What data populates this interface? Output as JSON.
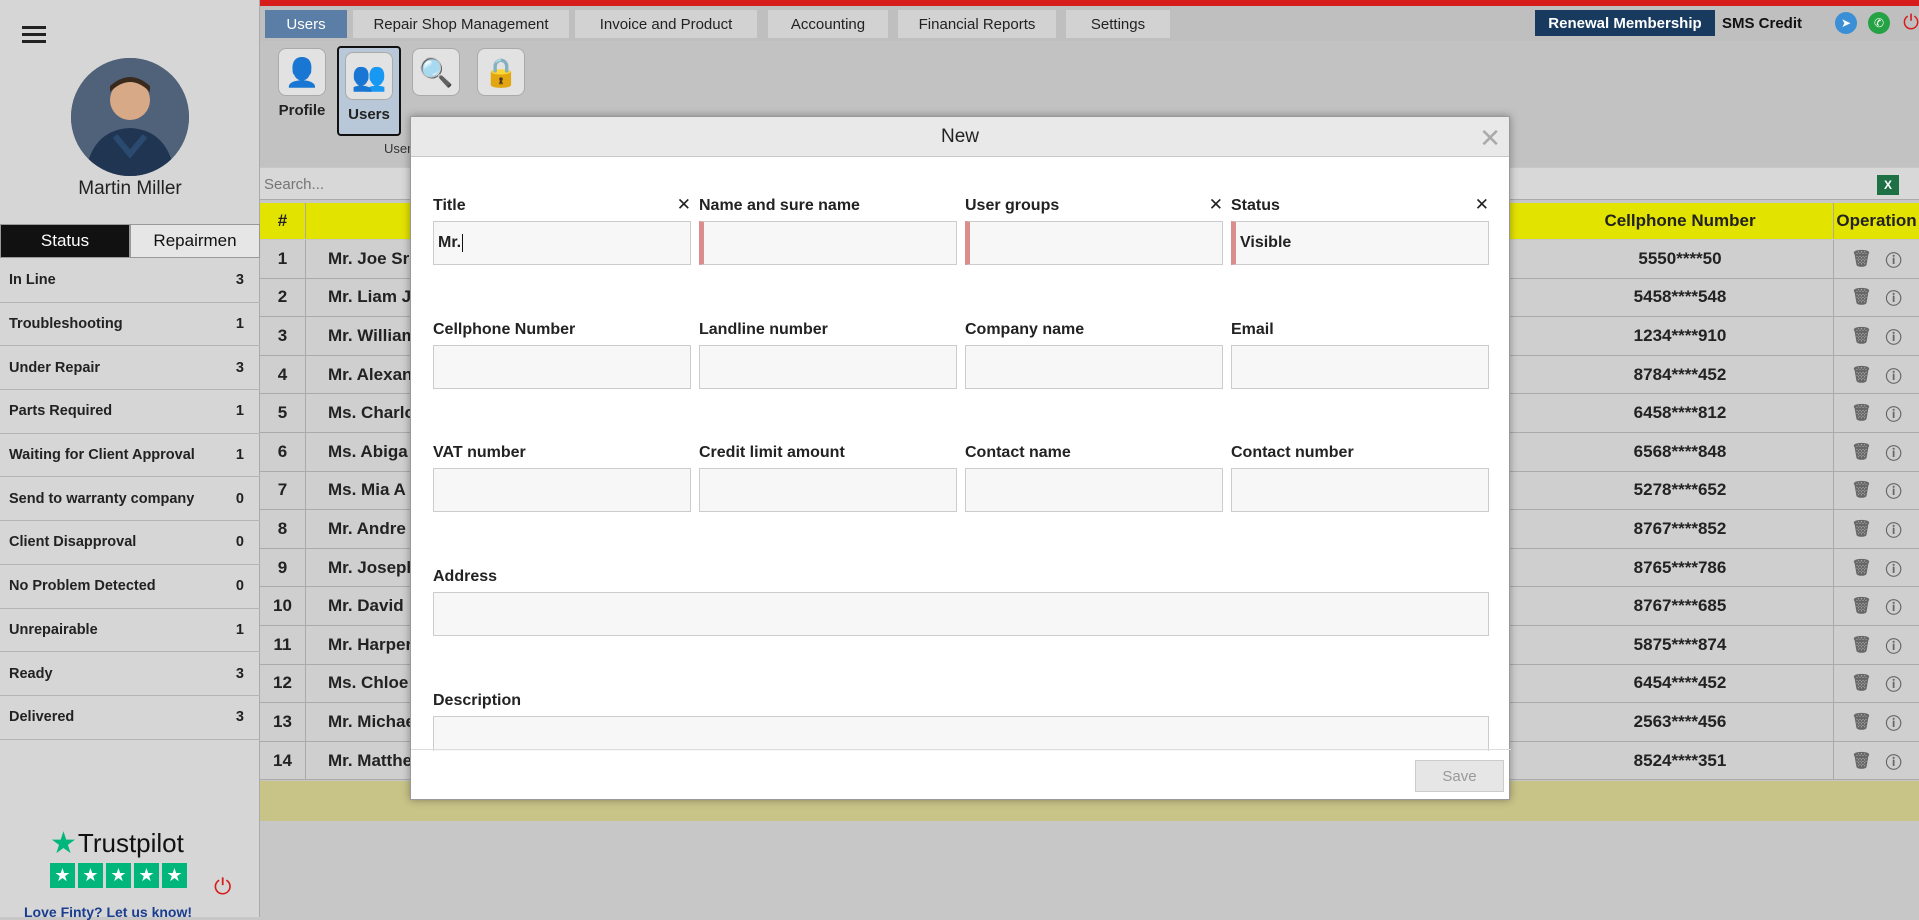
{
  "sidebar": {
    "user_name": "Martin Miller",
    "tabs": [
      "Status",
      "Repairmen"
    ],
    "status_items": [
      {
        "label": "In Line",
        "count": "3"
      },
      {
        "label": "Troubleshooting",
        "count": "1"
      },
      {
        "label": "Under Repair",
        "count": "3"
      },
      {
        "label": "Parts Required",
        "count": "1"
      },
      {
        "label": "Waiting for Client Approval",
        "count": "1"
      },
      {
        "label": "Send to warranty company",
        "count": "0"
      },
      {
        "label": "Client Disapproval",
        "count": "0"
      },
      {
        "label": "No Problem Detected",
        "count": "0"
      },
      {
        "label": "Unrepairable",
        "count": "1"
      },
      {
        "label": "Ready",
        "count": "3"
      },
      {
        "label": "Delivered",
        "count": "3"
      }
    ],
    "trustpilot": "Trustpilot",
    "love_text": "Love Finty? Let us know!"
  },
  "nav": {
    "tabs": [
      "Users",
      "Repair Shop Management",
      "Invoice and Product",
      "Accounting",
      "Financial Reports",
      "Settings"
    ],
    "renewal": "Renewal Membership",
    "sms": "SMS Credit"
  },
  "toolbar": {
    "items": [
      "Profile",
      "Users"
    ],
    "caption": "User"
  },
  "search": {
    "placeholder": "Search..."
  },
  "table": {
    "headers": {
      "num": "#",
      "phone": "Cellphone Number",
      "ops": "Operation"
    },
    "rows": [
      {
        "n": "1",
        "name": "Mr. Joe Sr",
        "phone": "5550****50"
      },
      {
        "n": "2",
        "name": "Mr. Liam J",
        "phone": "5458****548"
      },
      {
        "n": "3",
        "name": "Mr. William",
        "phone": "1234****910"
      },
      {
        "n": "4",
        "name": "Mr. Alexan",
        "phone": "8784****452"
      },
      {
        "n": "5",
        "name": "Ms. Charlo",
        "phone": "6458****812"
      },
      {
        "n": "6",
        "name": "Ms. Abiga",
        "phone": "6568****848"
      },
      {
        "n": "7",
        "name": "Ms. Mia A",
        "phone": "5278****652"
      },
      {
        "n": "8",
        "name": "Mr. Andre",
        "phone": "8767****852"
      },
      {
        "n": "9",
        "name": "Mr. Joseph",
        "phone": "8765****786"
      },
      {
        "n": "10",
        "name": "Mr. David",
        "phone": "8767****685"
      },
      {
        "n": "11",
        "name": "Mr. Harper",
        "phone": "5875****874"
      },
      {
        "n": "12",
        "name": "Ms. Chloe",
        "phone": "6454****452"
      },
      {
        "n": "13",
        "name": "Mr. Michae",
        "phone": "2563****456"
      },
      {
        "n": "14",
        "name": "Mr. Matthe",
        "phone": "8524****351"
      }
    ]
  },
  "modal": {
    "title": "New",
    "fields": {
      "title": {
        "label": "Title",
        "value": "Mr."
      },
      "name": {
        "label": "Name and sure name",
        "value": ""
      },
      "user_groups": {
        "label": "User groups",
        "value": ""
      },
      "status": {
        "label": "Status",
        "value": "Visible"
      },
      "cellphone": {
        "label": "Cellphone Number",
        "value": ""
      },
      "landline": {
        "label": "Landline number",
        "value": ""
      },
      "company": {
        "label": "Company name",
        "value": ""
      },
      "email": {
        "label": "Email",
        "value": ""
      },
      "vat": {
        "label": "VAT number",
        "value": ""
      },
      "credit": {
        "label": "Credit limit amount",
        "value": ""
      },
      "contact_name": {
        "label": "Contact name",
        "value": ""
      },
      "contact_number": {
        "label": "Contact number",
        "value": ""
      },
      "address": {
        "label": "Address",
        "value": ""
      },
      "description": {
        "label": "Description",
        "value": ""
      }
    },
    "save_label": "Save"
  },
  "colors": {
    "accent": "#5a7ea6",
    "header_yellow": "#e3e300",
    "brand_dark": "#173a5e",
    "alert_red": "#d71c1c",
    "trustpilot_green": "#00b67a"
  }
}
